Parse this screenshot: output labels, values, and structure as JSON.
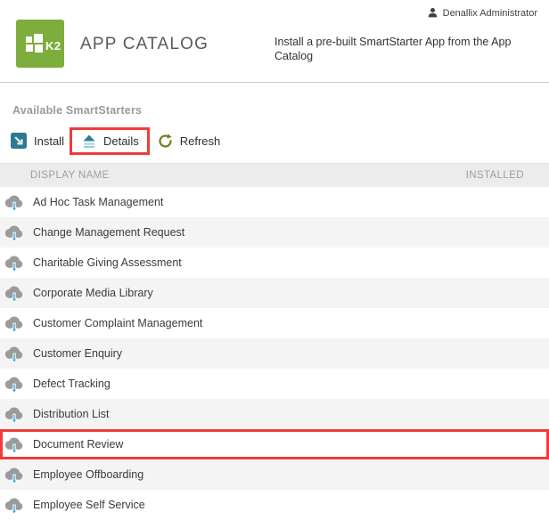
{
  "header": {
    "logo_text": "K2",
    "title": "APP CATALOG",
    "description": "Install a pre-built SmartStarter App from the App Catalog",
    "user_name": "Denallix Administrator"
  },
  "section_title": "Available SmartStarters",
  "toolbar": {
    "install": "Install",
    "details": "Details",
    "refresh": "Refresh"
  },
  "table": {
    "columns": [
      "DISPLAY NAME",
      "INSTALLED"
    ],
    "rows": [
      {
        "name": "Ad Hoc Task Management",
        "highlighted": false
      },
      {
        "name": "Change Management Request",
        "highlighted": false
      },
      {
        "name": "Charitable Giving Assessment",
        "highlighted": false
      },
      {
        "name": "Corporate Media Library",
        "highlighted": false
      },
      {
        "name": "Customer Complaint Management",
        "highlighted": false
      },
      {
        "name": "Customer Enquiry",
        "highlighted": false
      },
      {
        "name": "Defect Tracking",
        "highlighted": false
      },
      {
        "name": "Distribution List",
        "highlighted": false
      },
      {
        "name": "Document Review",
        "highlighted": true
      },
      {
        "name": "Employee Offboarding",
        "highlighted": false
      },
      {
        "name": "Employee Self Service",
        "highlighted": false
      }
    ]
  },
  "colors": {
    "brand_green": "#7dad3c",
    "teal_icon": "#2c7b93",
    "refresh_green": "#6f8020",
    "annotation_red": "#f03b3b",
    "alt_row_bg": "#f4f4f4"
  }
}
